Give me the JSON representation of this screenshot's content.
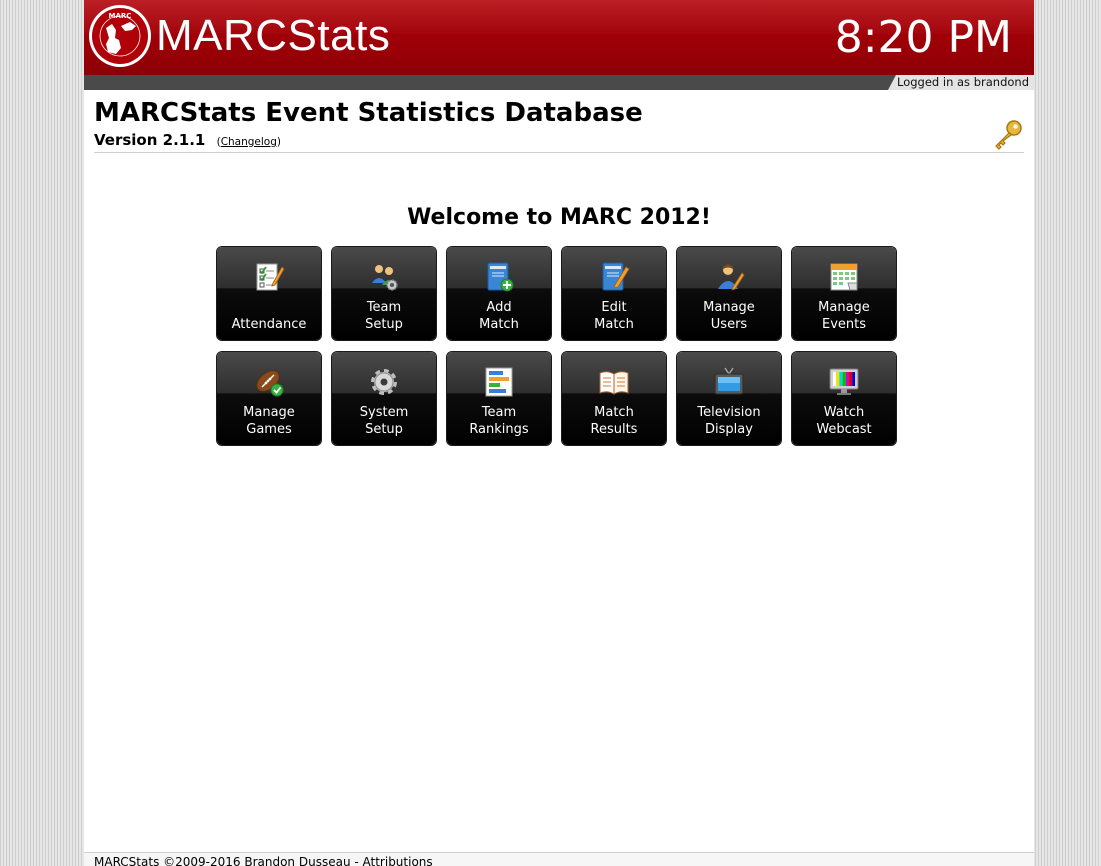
{
  "header": {
    "brand": "MARCStats",
    "seal_text": "MARC",
    "clock": "8:20 PM",
    "logged_in": "Logged in as brandond"
  },
  "titles": {
    "app_title": "MARCStats Event Statistics Database",
    "version": "Version 2.1.1",
    "changelog_open": "(",
    "changelog_label": "Changelog",
    "changelog_close": ")"
  },
  "welcome": "Welcome to MARC 2012!",
  "tiles": [
    {
      "label": "Attendance",
      "icon": "attendance-checklist-icon"
    },
    {
      "label": "Team\nSetup",
      "icon": "team-setup-icon"
    },
    {
      "label": "Add\nMatch",
      "icon": "add-match-icon"
    },
    {
      "label": "Edit\nMatch",
      "icon": "edit-match-icon"
    },
    {
      "label": "Manage\nUsers",
      "icon": "manage-users-icon"
    },
    {
      "label": "Manage\nEvents",
      "icon": "calendar-icon"
    },
    {
      "label": "Manage\nGames",
      "icon": "football-icon"
    },
    {
      "label": "System\nSetup",
      "icon": "gear-icon"
    },
    {
      "label": "Team\nRankings",
      "icon": "rankings-chart-icon"
    },
    {
      "label": "Match\nResults",
      "icon": "open-book-icon"
    },
    {
      "label": "Television\nDisplay",
      "icon": "television-icon"
    },
    {
      "label": "Watch\nWebcast",
      "icon": "webcast-monitor-icon"
    }
  ],
  "footer": {
    "text": "MARCStats ©2009-2016 Brandon Dusseau - ",
    "attributions": "Attributions"
  },
  "colors": {
    "header_red": "#a10007",
    "subbar": "#4a4a4a",
    "tile_black": "#000000"
  }
}
